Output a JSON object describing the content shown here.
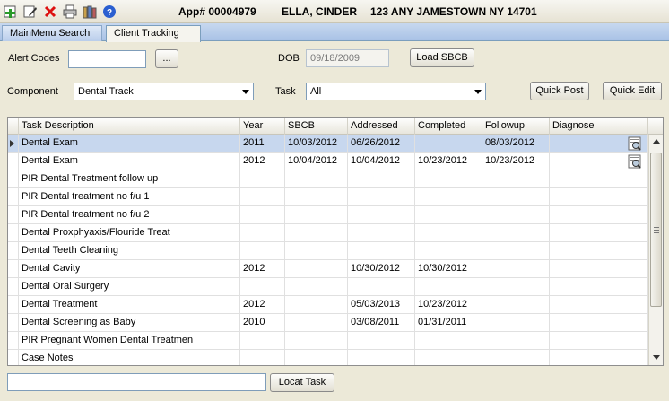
{
  "toolbar": {
    "icons": [
      "add-icon",
      "edit-icon",
      "delete-icon",
      "print-icon",
      "books-icon",
      "help-icon"
    ],
    "app_no": "App# 00004979",
    "client_name": "ELLA, CINDER",
    "address": "123 ANY JAMESTOWN NY 14701"
  },
  "tabs": [
    {
      "label": "MainMenu Search",
      "active": false
    },
    {
      "label": "Client Tracking",
      "active": true
    }
  ],
  "form": {
    "alert_codes_label": "Alert Codes",
    "alert_codes_value": "",
    "browse_button": "...",
    "dob_label": "DOB",
    "dob_value": "09/18/2009",
    "load_sbcb_button": "Load SBCB",
    "component_label": "Component",
    "component_value": "Dental Track",
    "task_label": "Task",
    "task_value": "All",
    "quick_post_button": "Quick Post",
    "quick_edit_button": "Quick Edit"
  },
  "grid": {
    "columns": [
      "Task Description",
      "Year",
      "SBCB",
      "Addressed",
      "Completed",
      "Followup",
      "Diagnose"
    ],
    "rows": [
      [
        "Dental Exam",
        "2011",
        "10/03/2012",
        "06/26/2012",
        "",
        "08/03/2012",
        ""
      ],
      [
        "Dental Exam",
        "2012",
        "10/04/2012",
        "10/04/2012",
        "10/23/2012",
        "10/23/2012",
        ""
      ],
      [
        " PIR Dental Treatment follow up",
        "",
        "",
        "",
        "",
        "",
        ""
      ],
      [
        " PIR Dental treatment no f/u 1",
        "",
        "",
        "",
        "",
        "",
        ""
      ],
      [
        " PIR Dental treatment no f/u 2",
        "",
        "",
        "",
        "",
        "",
        ""
      ],
      [
        "Dental Proxphyaxis/Flouride Treat",
        "",
        "",
        "",
        "",
        "",
        ""
      ],
      [
        "Dental Teeth Cleaning",
        "",
        "",
        "",
        "",
        "",
        ""
      ],
      [
        "Dental Cavity",
        "2012",
        "",
        "10/30/2012",
        "10/30/2012",
        "",
        ""
      ],
      [
        "Dental Oral Surgery",
        "",
        "",
        "",
        "",
        "",
        ""
      ],
      [
        "Dental Treatment",
        "2012",
        "",
        "05/03/2013",
        "10/23/2012",
        "",
        ""
      ],
      [
        "Dental Screening as Baby",
        "2010",
        "",
        "03/08/2011",
        "01/31/2011",
        "",
        ""
      ],
      [
        " PIR Pregnant Women Dental Treatmen",
        "",
        "",
        "",
        "",
        "",
        ""
      ],
      [
        "Case Notes",
        "",
        "",
        "",
        "",
        "",
        ""
      ]
    ]
  },
  "bottom": {
    "search_value": "",
    "locate_button": "Locat Task"
  }
}
